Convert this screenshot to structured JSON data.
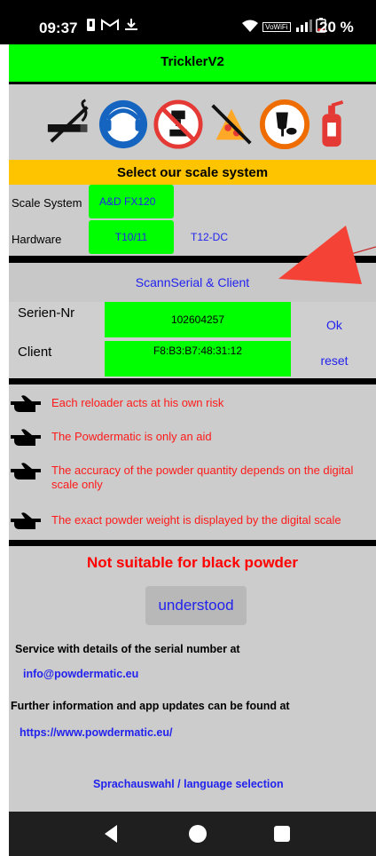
{
  "status_bar": {
    "time": "09:37",
    "left_icons": [
      "notification-icon",
      "gmail-icon",
      "download-icon"
    ],
    "right_icons": [
      "wifi-icon",
      "volte-icon",
      "signal-icon",
      "battery-icon"
    ],
    "volte_text": "VoWiFi",
    "battery": "20 %"
  },
  "app": {
    "title": "TricklerV2",
    "prohibition_icons": [
      "no-smoking-icon",
      "ear-protection-icon",
      "no-drinking-icon",
      "no-eating-icon",
      "eye-protection-icon",
      "fire-extinguisher-icon"
    ],
    "select_header": "Select our scale system",
    "scale_system": {
      "label": "Scale System",
      "value": "A&D FX120"
    },
    "hardware": {
      "label": "Hardware",
      "option_selected": "T10/11",
      "option_other": "T12-DC"
    },
    "scan_button": "ScannSerial & Client",
    "serial": {
      "label": "Serien-Nr",
      "value": "102604257",
      "ok_label": "Ok"
    },
    "client": {
      "label": "Client",
      "value": "F8:B3:B7:48:31:12",
      "reset_label": "reset"
    },
    "warnings": [
      "Each reloader acts at his own risk",
      "The Powdermatic is only an aid",
      "The accuracy of the powder quantity depends on the digital scale only",
      "The exact powder weight is displayed by the digital scale"
    ],
    "not_suitable": "Not suitable for black powder",
    "understood_button": "understood",
    "service_text": "Service with details of the serial number at",
    "service_email": "info@powdermatic.eu",
    "further_info": "Further information and app updates can be found at",
    "website": "https://www.powdermatic.eu/",
    "language_link": "Sprachauswahl /  language selection"
  },
  "nav": [
    "back-icon",
    "home-icon",
    "recents-icon"
  ],
  "colors": {
    "title_green": "#00ff00",
    "header_yellow": "#ffc400",
    "link_blue": "#2222ee",
    "warning_red": "#ff1a1a",
    "panel_gray": "#cccccc"
  }
}
